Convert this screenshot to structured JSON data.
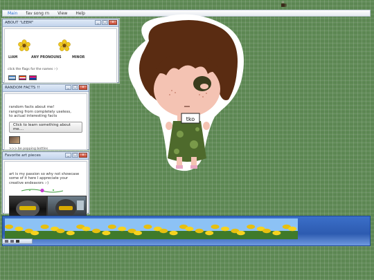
{
  "menubar": {
    "items": [
      "Main",
      "fav song rn",
      "View",
      "Help"
    ]
  },
  "about_window": {
    "title": "ABOUT \"LEEM\"",
    "names": [
      "LIAM",
      "ANY PRONOUNS",
      "MINOR"
    ],
    "note": "click the flags for the names :-)"
  },
  "facts_window": {
    "title": "RANDOM FACTS !!",
    "text_lines": [
      "random facts about me!",
      "ranging from completely useless,",
      "to actual interesting facts"
    ],
    "button_label": "Click to learn something about me....",
    "note": ">>> be popping bottles"
  },
  "art_window": {
    "title": "Favorite art pieces",
    "text": "art is my passion so why not showcase some of it here I appreciate your creative endeavors :-)"
  },
  "character": {
    "sign_text": "tko"
  },
  "colors": {
    "background": "#5f8a55",
    "accent": "#2a6fd6",
    "dock": "#2d5bb0"
  },
  "icons": [
    "flower-icon",
    "flag-icon",
    "close-icon",
    "minimize-icon",
    "maximize-icon",
    "coffee-icon"
  ]
}
